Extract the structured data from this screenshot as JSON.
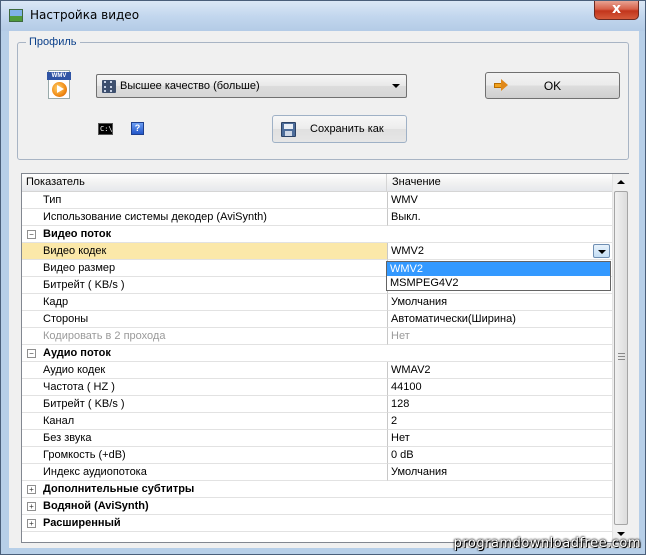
{
  "window": {
    "title": "Настройка видео",
    "close_label": "x"
  },
  "profile": {
    "group_label": "Профиль",
    "icon_tag": "WMV",
    "selected": "Высшее качество (больше)",
    "ok_label": "OK",
    "save_as_label": "Сохранить как",
    "cmd_icon_text": "C:\\",
    "help_icon_text": "?"
  },
  "grid": {
    "headers": {
      "name": "Показатель",
      "value": "Значение"
    },
    "rows": [
      {
        "name": "Тип",
        "value": "WMV"
      },
      {
        "name": "Использование системы декодер (AviSynth)",
        "value": "Выкл."
      },
      {
        "name": "Видео поток",
        "category": true,
        "expander": "−"
      },
      {
        "name": "Видео кодек",
        "value": "WMV2",
        "selected": true
      },
      {
        "name": "Видео размер",
        "value": ""
      },
      {
        "name": "Битрейт ( KB/s )",
        "value": ""
      },
      {
        "name": "Кадр",
        "value": "Умолчания"
      },
      {
        "name": "Стороны",
        "value": "Автоматически(Ширина)"
      },
      {
        "name": "Кодировать в 2 прохода",
        "value": "Нет",
        "disabled": true
      },
      {
        "name": "Аудио поток",
        "category": true,
        "expander": "−"
      },
      {
        "name": "Аудио кодек",
        "value": "WMAV2"
      },
      {
        "name": "Частота ( HZ )",
        "value": "44100"
      },
      {
        "name": "Битрейт ( KB/s )",
        "value": "128"
      },
      {
        "name": "Канал",
        "value": "2"
      },
      {
        "name": "Без звука",
        "value": "Нет"
      },
      {
        "name": "Громкость (+dB)",
        "value": "0 dB"
      },
      {
        "name": "Индекс аудиопотока",
        "value": "Умолчания"
      },
      {
        "name": "Дополнительные субтитры",
        "category": true,
        "expander": "+"
      },
      {
        "name": "Водяной (AviSynth)",
        "category": true,
        "expander": "+"
      },
      {
        "name": "Расширенный",
        "category": true,
        "expander": "+"
      }
    ],
    "codec_dropdown": {
      "options": [
        "WMV2",
        "MSMPEG4V2"
      ],
      "selected_index": 0
    }
  },
  "watermark": "programdownloadfree.com"
}
